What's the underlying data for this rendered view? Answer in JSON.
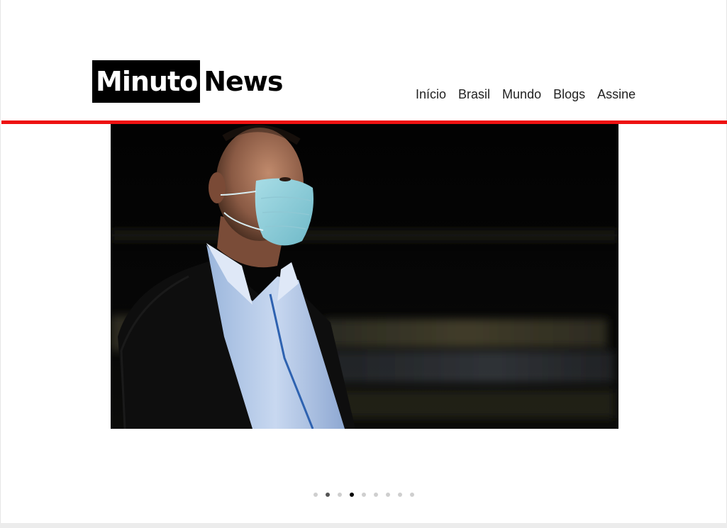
{
  "brand": {
    "logo_part1": "Minuto",
    "logo_part2": "News",
    "accent_color": "#ee1111"
  },
  "nav": {
    "items": [
      {
        "label": "Início"
      },
      {
        "label": "Brasil"
      },
      {
        "label": "Mundo"
      },
      {
        "label": "Blogs"
      },
      {
        "label": "Assine"
      }
    ]
  },
  "carousel": {
    "slide_count": 9,
    "active_index": 3,
    "image_subject": "man-wearing-surgical-mask-photo"
  }
}
